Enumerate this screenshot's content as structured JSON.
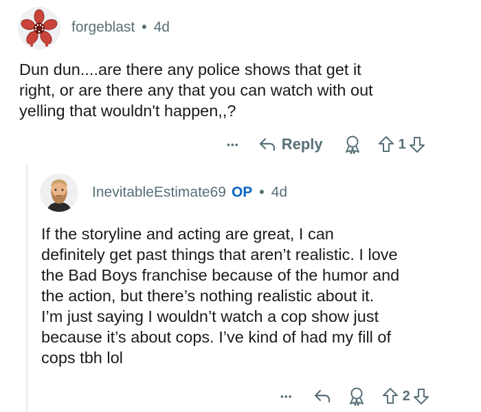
{
  "comment1": {
    "username": "forgeblast",
    "separator": "•",
    "time": "4d",
    "body_lines": [
      "Dun dun....are there any police shows that get it",
      "right, or are there any that you can watch with out",
      "yelling that wouldn't happen,,?"
    ],
    "actions": {
      "more": "•••",
      "reply_label": "Reply",
      "vote_count": "1"
    }
  },
  "comment2": {
    "username": "InevitableEstimate69",
    "op_badge": "OP",
    "separator": "•",
    "time": "4d",
    "body_lines": [
      "If the storyline and acting are great, I can",
      "definitely get past things that aren’t realistic. I love",
      "the Bad Boys franchise because of the humor and",
      "the action, but there’s nothing realistic about it.",
      "I’m just saying I wouldn’t watch a cop show just",
      "because it’s about cops. I’ve kind of had my fill of",
      "cops tbh lol"
    ],
    "actions": {
      "more": "•••",
      "vote_count": "2"
    }
  },
  "icons": [
    "demogorgon-avatar",
    "bearded-man-avatar",
    "more-icon",
    "reply-icon",
    "award-icon",
    "upvote-icon",
    "downvote-icon"
  ],
  "colors": {
    "meta": "#576f76",
    "op": "#0a65c2",
    "text": "#1a1a1b",
    "thread_line": "#e4e8ea"
  }
}
